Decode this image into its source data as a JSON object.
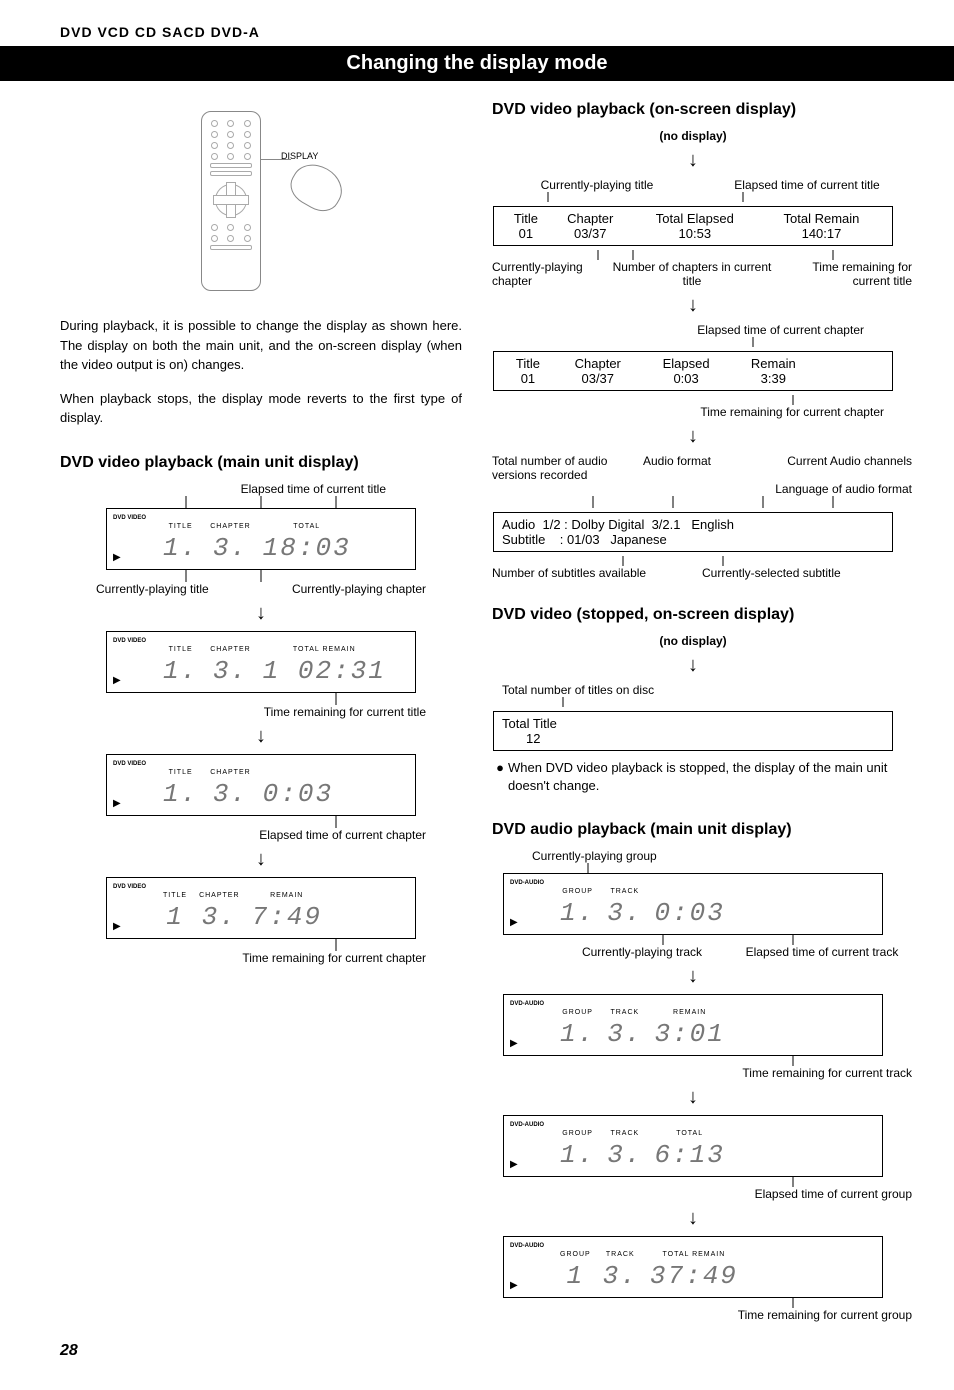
{
  "formats": "DVD   VCD   CD   SACD   DVD-A",
  "page_title": "Changing the display mode",
  "remote_label": "DISPLAY",
  "intro": {
    "p1": "During playback, it is possible to change the display as shown here. The display on both the main unit, and the on-screen display (when the video output is on) changes.",
    "p2": "When playback stops, the display mode reverts to the first type of display."
  },
  "left": {
    "heading": "DVD video playback (main unit display)",
    "annot_top": "Elapsed time of current title",
    "lcd1": {
      "media": "DVD\nVIDEO",
      "h_title": "TITLE",
      "h_chapter": "CHAPTER",
      "h_total": "TOTAL",
      "title": "1.",
      "chapter": "3.",
      "time": "18:03"
    },
    "annot_under1_left": "Currently-playing title",
    "annot_under1_right": "Currently-playing chapter",
    "lcd2": {
      "media": "DVD\nVIDEO",
      "h_title": "TITLE",
      "h_chapter": "CHAPTER",
      "h_total": "TOTAL REMAIN",
      "title": "1.",
      "chapter": "3.",
      "time": "1 02:31"
    },
    "annot_under2": "Time remaining for current title",
    "lcd3": {
      "media": "DVD\nVIDEO",
      "h_title": "TITLE",
      "h_chapter": "CHAPTER",
      "title": "1.",
      "chapter": "3.",
      "time": "0:03"
    },
    "annot_under3": "Elapsed time of current chapter",
    "lcd4": {
      "media": "DVD\nVIDEO",
      "h_title": "TITLE",
      "h_chapter": "CHAPTER",
      "h_remain": "REMAIN",
      "title": "1",
      "chapter": "3.",
      "time": "7:49"
    },
    "annot_under4": "Time remaining for current chapter"
  },
  "right": {
    "heading1": "DVD video playback (on-screen display)",
    "no_display": "(no display)",
    "ann_a_left": "Currently-playing title",
    "ann_a_right": "Elapsed time of current title",
    "osd1": {
      "h1": "Title",
      "h2": "Chapter",
      "h3": "Total Elapsed",
      "h4": "Total Remain",
      "v1": "01",
      "v2": "03/37",
      "v3": "10:53",
      "v4": "140:17"
    },
    "ann_b_left": "Currently-playing chapter",
    "ann_b_mid": "Number of chapters in current title",
    "ann_b_right": "Time remaining for current title",
    "ann_c": "Elapsed time of current chapter",
    "osd2": {
      "h1": "Title",
      "h2": "Chapter",
      "h3": "Elapsed",
      "h4": "Remain",
      "v1": "01",
      "v2": "03/37",
      "v3": "0:03",
      "v4": "3:39"
    },
    "ann_d": "Time remaining for current chapter",
    "ann_e1": "Total number of audio versions recorded",
    "ann_e2": "Audio format",
    "ann_e3": "Current Audio channels",
    "ann_e4": "Language of audio format",
    "osd3_line1": "Audio  1/2 : Dolby Digital  3/2.1   English",
    "osd3_line2": "Subtitle    : 01/03   Japanese",
    "ann_f1": "Number of subtitles available",
    "ann_f2": "Currently-selected subtitle",
    "heading2": "DVD video (stopped, on-screen display)",
    "ann_g": "Total number of titles on disc",
    "osd4": {
      "h": "Total Title",
      "v": "12"
    },
    "bullet": "When DVD video playback is stopped, the display of the main unit doesn't change.",
    "heading3": "DVD audio playback (main unit display)",
    "ann_h_top": "Currently-playing group",
    "lcdA1": {
      "media": "DVD-AUDIO",
      "h_group": "GROUP",
      "h_track": "TRACK",
      "group": "1.",
      "track": "3.",
      "time": "0:03"
    },
    "ann_h_left": "Currently-playing track",
    "ann_h_right": "Elapsed time of current track",
    "lcdA2": {
      "media": "DVD-AUDIO",
      "h_group": "GROUP",
      "h_track": "TRACK",
      "h_remain": "REMAIN",
      "group": "1.",
      "track": "3.",
      "time": "3:01"
    },
    "ann_A2": "Time remaining for current track",
    "lcdA3": {
      "media": "DVD-AUDIO",
      "h_group": "GROUP",
      "h_track": "TRACK",
      "h_total": "TOTAL",
      "group": "1.",
      "track": "3.",
      "time": "6:13"
    },
    "ann_A3": "Elapsed time of current group",
    "lcdA4": {
      "media": "DVD-AUDIO",
      "h_group": "GROUP",
      "h_track": "TRACK",
      "h_total": "TOTAL REMAIN",
      "group": "1",
      "track": "3.",
      "time": "37:49"
    },
    "ann_A4": "Time remaining for current group"
  },
  "page_number": "28",
  "glyphs": {
    "play": "▶",
    "down": "↓"
  }
}
